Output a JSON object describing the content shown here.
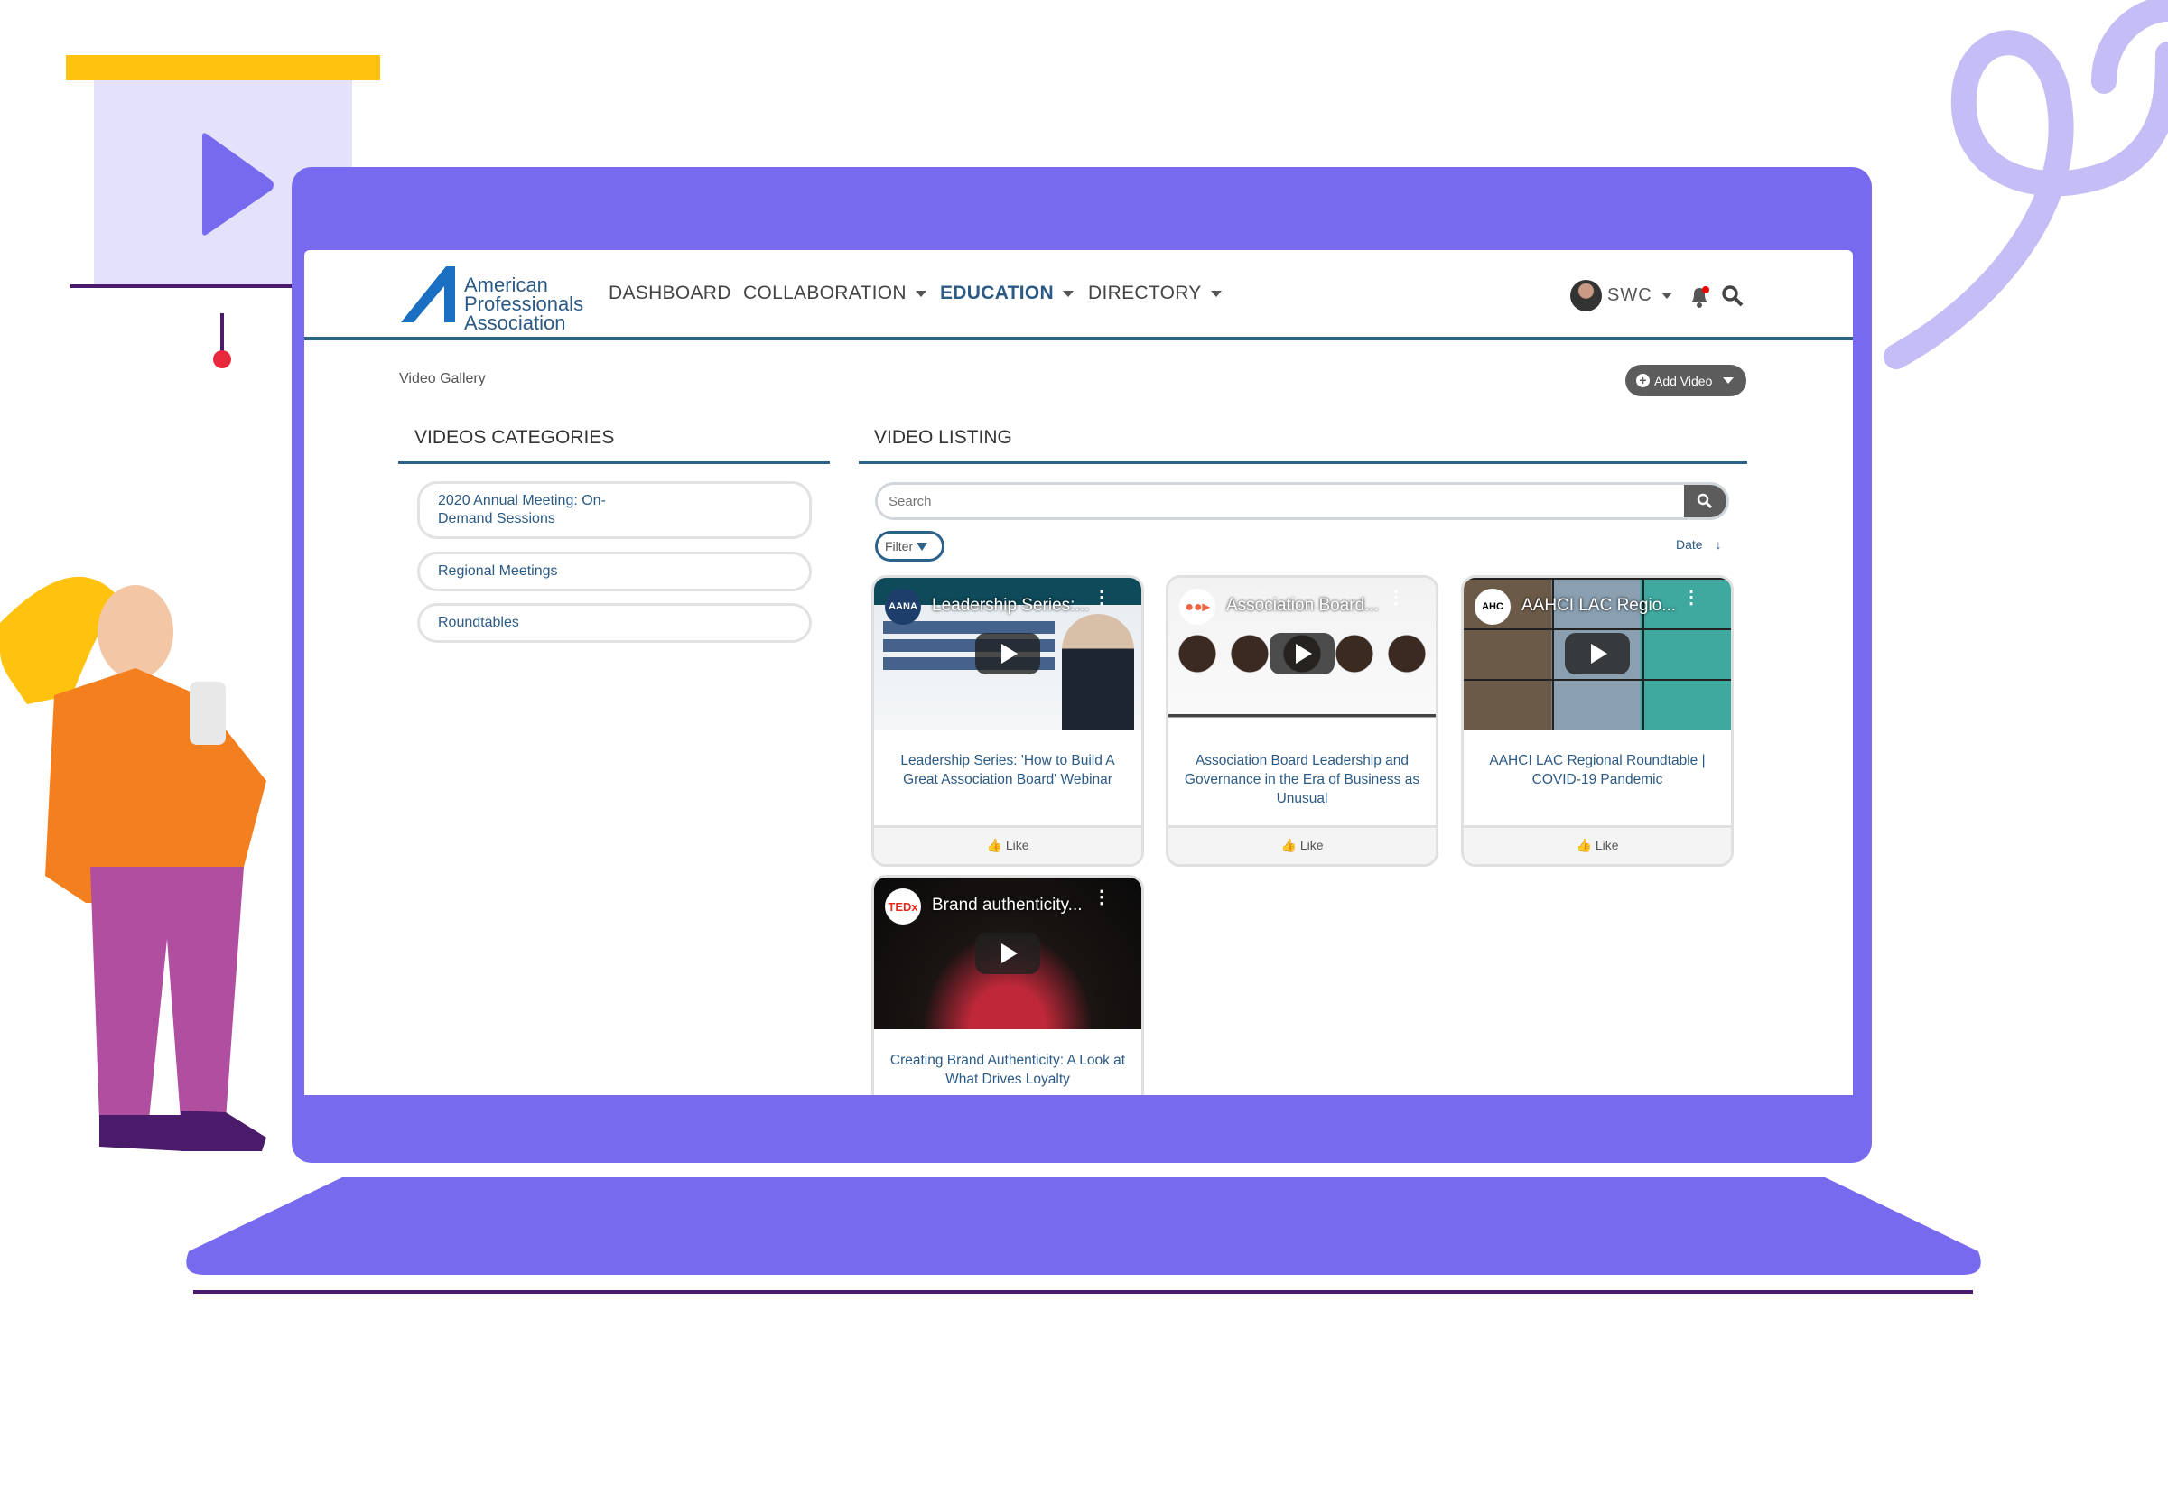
{
  "colors": {
    "frame": "#786aee",
    "accent": "#2c6289",
    "text_blue": "#2b5a85",
    "button_dark": "#5c5c5c",
    "decor_lavender": "#c5bdf5",
    "decor_yellow": "#ffc20e"
  },
  "header": {
    "logo": {
      "line1": "American",
      "line2": "Professionals",
      "line3": "Association"
    },
    "nav": [
      {
        "label": "DASHBOARD",
        "dropdown": false
      },
      {
        "label": "COLLABORATION",
        "dropdown": true
      },
      {
        "label": "EDUCATION",
        "dropdown": true,
        "active": true
      },
      {
        "label": "DIRECTORY",
        "dropdown": true
      }
    ],
    "user": {
      "name": "SWC",
      "icon": "avatar"
    },
    "icons": [
      "bell-icon",
      "search-icon"
    ]
  },
  "breadcrumb": "Video Gallery",
  "add_video": {
    "label": "Add Video",
    "icon": "plus-circle-icon"
  },
  "categories": {
    "title": "VIDEOS CATEGORIES",
    "items": [
      {
        "label": "2020 Annual Meeting: On-Demand Sessions"
      },
      {
        "label": "Regional Meetings"
      },
      {
        "label": "Roundtables"
      }
    ]
  },
  "listing": {
    "title": "VIDEO LISTING",
    "search_placeholder": "Search",
    "filter_label": "Filter",
    "sort_label": "Date",
    "like_label": "Like",
    "videos": [
      {
        "channel": "AANA",
        "thumb_title": "Leadership Series:...",
        "title": "Leadership Series: 'How to Build A Great Association Board' Webinar"
      },
      {
        "channel": "",
        "thumb_title": "Association Board...",
        "title": "Association Board Leadership and Governance in the Era of Business as Unusual"
      },
      {
        "channel": "AHC",
        "thumb_title": "AAHCI LAC Regio...",
        "title": "AAHCI LAC Regional Roundtable | COVID-19 Pandemic"
      },
      {
        "channel": "TEDx",
        "thumb_title": "Brand authenticity...",
        "title": "Creating Brand Authenticity: A Look at What Drives Loyalty"
      }
    ]
  }
}
